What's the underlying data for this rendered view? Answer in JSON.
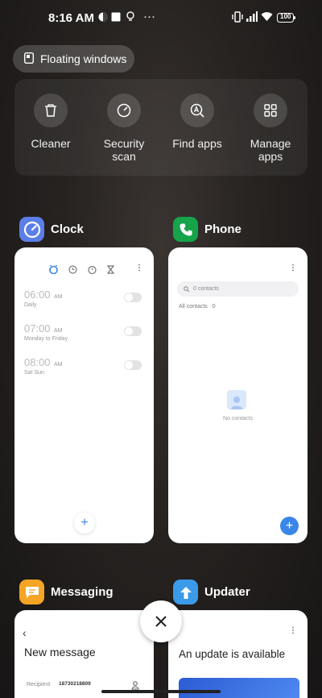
{
  "status": {
    "time": "8:16 AM",
    "dots": "···",
    "battery": "100"
  },
  "floating_windows_label": "Floating windows",
  "tools": [
    {
      "label": "Cleaner",
      "icon": "trash-icon"
    },
    {
      "label": "Security scan",
      "icon": "security-gauge-icon"
    },
    {
      "label": "Find apps",
      "icon": "find-apps-icon"
    },
    {
      "label": "Manage apps",
      "icon": "grid-icon"
    }
  ],
  "apps": {
    "clock": {
      "name": "Clock",
      "alarms": [
        {
          "time": "06:00",
          "ampm": "AM",
          "sub": "Daily"
        },
        {
          "time": "07:00",
          "ampm": "AM",
          "sub": "Monday to Friday"
        },
        {
          "time": "08:00",
          "ampm": "AM",
          "sub": "Sat Sun"
        }
      ],
      "add_label": "+"
    },
    "phone": {
      "name": "Phone",
      "search_placeholder": "0 contacts",
      "all_contacts": "All contacts",
      "count": "0",
      "empty": "No contacts",
      "add_label": "+"
    },
    "messaging": {
      "name": "Messaging",
      "title": "New message",
      "recipient_label": "Recipient",
      "recipient_value": "18730218809"
    },
    "updater": {
      "name": "Updater",
      "title": "An update is available"
    }
  },
  "colors": {
    "clock_icon": "#5b7fe8",
    "phone_icon": "#16a34a",
    "messaging_icon": "#f5a524",
    "updater_icon": "#3b9be8",
    "accent": "#3a86e8"
  }
}
